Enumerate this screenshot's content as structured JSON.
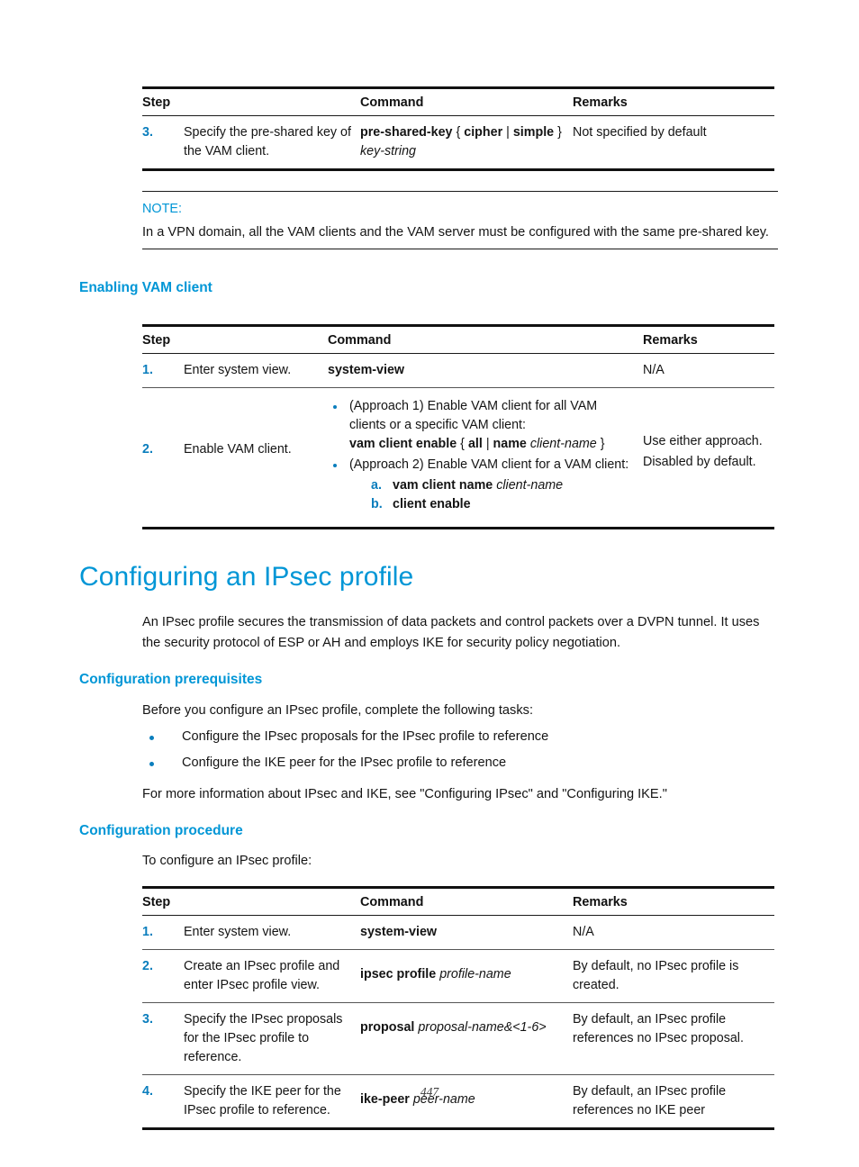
{
  "page": {
    "number": "447"
  },
  "table_headers": {
    "step": "Step",
    "command": "Command",
    "remarks": "Remarks"
  },
  "table_pre_shared_key": {
    "rows": [
      {
        "num": "3.",
        "desc": "Specify the pre-shared key of the VAM client.",
        "cmd_bold_1": "pre-shared-key",
        "cmd_plain_1": " { ",
        "cmd_bold_2": "cipher",
        "cmd_plain_2": " | ",
        "cmd_bold_3": "simple",
        "cmd_plain_3": " }",
        "cmd_italic": "key-string",
        "remarks": "Not specified by default"
      }
    ]
  },
  "note": {
    "label": "NOTE:",
    "text": "In a VPN domain, all the VAM clients and the VAM server must be configured with the same pre-shared key."
  },
  "section_enabling_vam_client": {
    "heading": "Enabling VAM client",
    "row1": {
      "num": "1.",
      "desc": "Enter system view.",
      "cmd": "system-view",
      "remarks": "N/A"
    },
    "row2": {
      "num": "2.",
      "desc": "Enable VAM client.",
      "bullet1_line1": "(Approach 1) Enable VAM client for all VAM clients or a specific VAM client:",
      "bullet1_cmd_b1": "vam client enable",
      "bullet1_cmd_p1": " { ",
      "bullet1_cmd_b2": "all",
      "bullet1_cmd_p2": " | ",
      "bullet1_cmd_b3": "name",
      "bullet1_cmd_i1": "client-name",
      "bullet1_cmd_p3": " }",
      "bullet2_line1": "(Approach 2) Enable VAM client for a VAM client:",
      "sub_a_label": "a.",
      "sub_a_bold": "vam client name",
      "sub_a_italic": "client-name",
      "sub_b_label": "b.",
      "sub_b_bold": "client enable",
      "remarks_line1": "Use either approach.",
      "remarks_line2": "Disabled by default."
    }
  },
  "section_ipsec_profile": {
    "heading": "Configuring an IPsec profile",
    "intro": "An IPsec profile secures the transmission of data packets and control packets over a DVPN tunnel. It uses the security protocol of ESP or AH and employs IKE for security policy negotiation.",
    "prerequisites": {
      "heading": "Configuration prerequisites",
      "intro": "Before you configure an IPsec profile, complete the following tasks:",
      "items": [
        "Configure the IPsec proposals for the IPsec profile to reference",
        "Configure the IKE peer for the IPsec profile to reference"
      ],
      "outro": "For more information about IPsec and IKE, see \"Configuring IPsec\" and \"Configuring IKE.\""
    },
    "procedure": {
      "heading": "Configuration procedure",
      "intro": "To configure an IPsec profile:",
      "rows": [
        {
          "num": "1.",
          "desc": "Enter system view.",
          "cmd_bold": "system-view",
          "cmd_italic": "",
          "remarks": "N/A"
        },
        {
          "num": "2.",
          "desc": "Create an IPsec profile and enter IPsec profile view.",
          "cmd_bold": "ipsec profile",
          "cmd_italic": "profile-name",
          "remarks": "By default, no IPsec profile is created."
        },
        {
          "num": "3.",
          "desc": "Specify the IPsec proposals for the IPsec profile to reference.",
          "cmd_bold": "proposal",
          "cmd_italic": "proposal-name&<1-6>",
          "remarks": "By default, an IPsec profile references no IPsec proposal."
        },
        {
          "num": "4.",
          "desc": "Specify the IKE peer for the IPsec profile to reference.",
          "cmd_bold": "ike-peer",
          "cmd_italic": "peer-name",
          "remarks": "By default, an IPsec profile references no IKE peer"
        }
      ]
    }
  }
}
